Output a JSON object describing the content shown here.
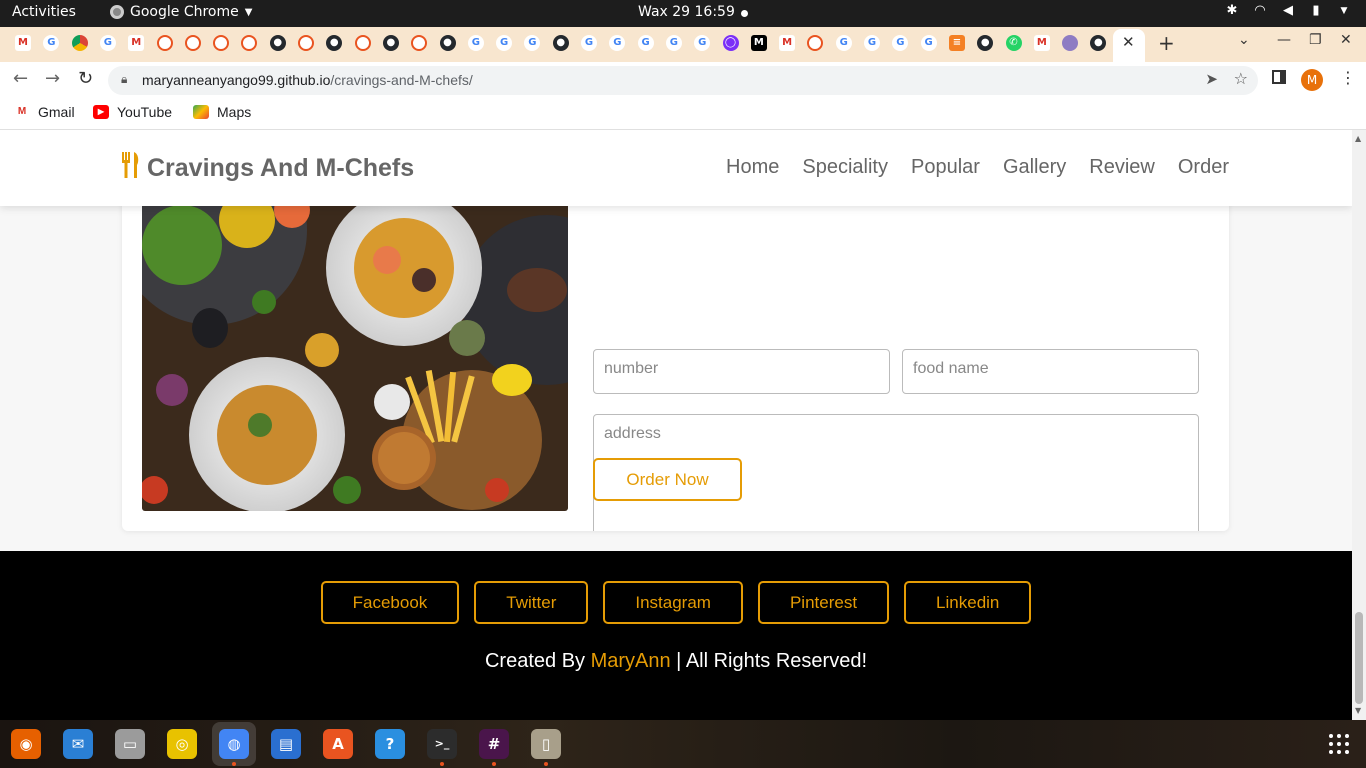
{
  "system_bar": {
    "activities": "Activities",
    "app_name": "Google Chrome",
    "clock": "Wax 29  16:59"
  },
  "browser": {
    "url_host": "maryanneanyango99.github.io",
    "url_path": "/cravings-and-M-chefs/",
    "profile_initial": "M",
    "bookmarks": [
      {
        "label": "Gmail",
        "icon": "gmail-icon"
      },
      {
        "label": "YouTube",
        "icon": "youtube-icon"
      },
      {
        "label": "Maps",
        "icon": "maps-icon"
      }
    ],
    "tab_favicons": [
      "gmail",
      "google",
      "chrome",
      "google",
      "gmail",
      "ubuntu",
      "ubuntu",
      "ubuntu",
      "ubuntu",
      "github",
      "ubuntu",
      "github",
      "ubuntu",
      "github",
      "ubuntu",
      "github",
      "google",
      "google",
      "google",
      "github",
      "google",
      "google",
      "google",
      "google",
      "google",
      "purple",
      "medium",
      "gmail",
      "ubuntu",
      "google",
      "google",
      "google",
      "google",
      "so",
      "github",
      "wa",
      "gmail",
      "misc",
      "github"
    ]
  },
  "site": {
    "logo_text": "Cravings And M-Chefs",
    "nav": [
      "Home",
      "Speciality",
      "Popular",
      "Gallery",
      "Review",
      "Order"
    ],
    "form": {
      "number_placeholder": "number",
      "food_placeholder": "food name",
      "address_placeholder": "address",
      "submit_label": "Order Now"
    },
    "social": [
      "Facebook",
      "Twitter",
      "Instagram",
      "Pinterest",
      "Linkedin"
    ],
    "credit": {
      "prefix": "Created By ",
      "author": "MaryAnn",
      "suffix": " | All Rights Reserved!"
    },
    "accent_color": "#e59c05"
  },
  "dock": {
    "apps": [
      "firefox-icon",
      "thunderbird-icon",
      "files-icon",
      "rhythmbox-icon",
      "chrome-icon",
      "writer-icon",
      "software-icon",
      "help-icon",
      "terminal-icon",
      "slack-icon",
      "archive-icon"
    ]
  }
}
